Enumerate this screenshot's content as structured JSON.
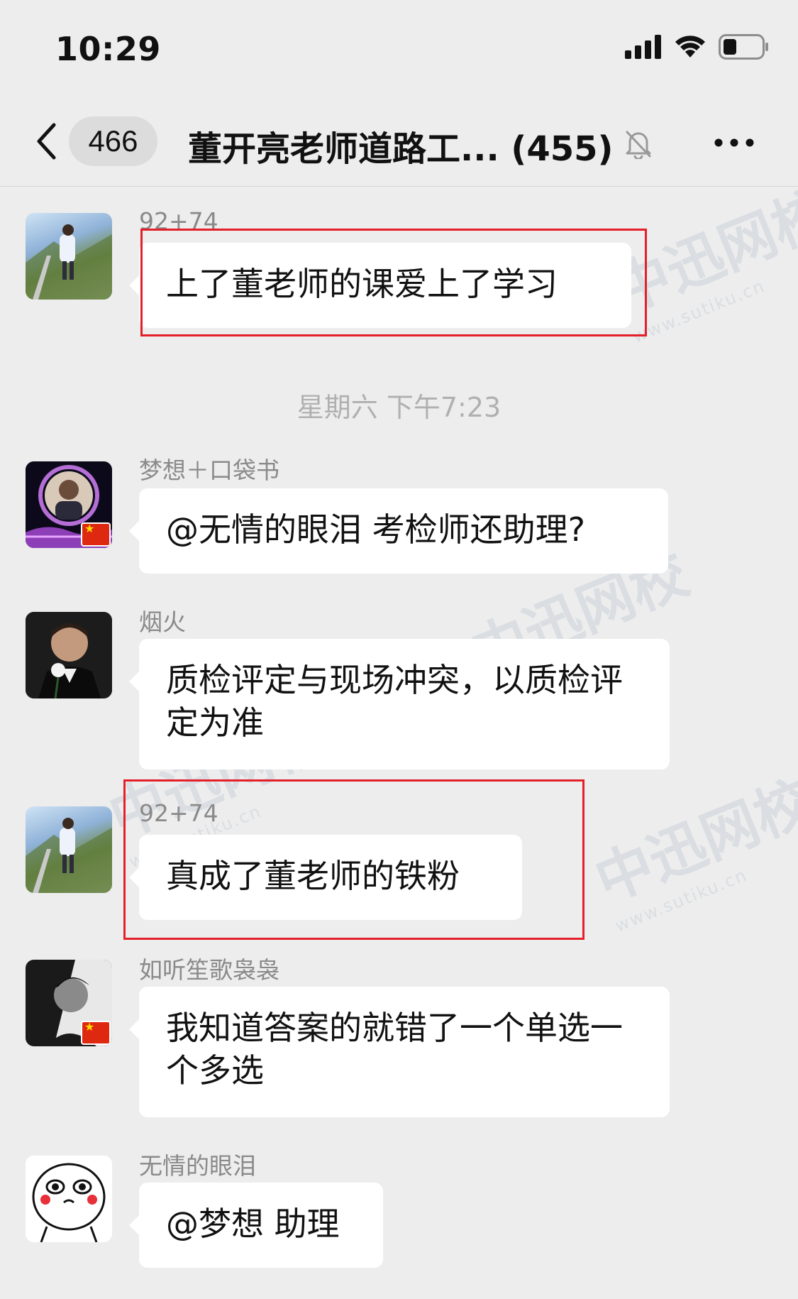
{
  "status_bar": {
    "time": "10:29"
  },
  "header": {
    "unread_count": "466",
    "title": "董开亮老师道路工... (455)"
  },
  "messages": [
    {
      "sender": "92+74",
      "text": "上了董老师的课爱上了学习",
      "avatar": "landscape-avatar"
    },
    {
      "sender": "梦想＋口袋书",
      "text": "@无情的眼泪 考检师还助理?",
      "avatar": "portrait-night-avatar"
    },
    {
      "sender": "烟火",
      "text": "质检评定与现场冲突，以质检评定为准",
      "avatar": "suit-rose-avatar"
    },
    {
      "sender": "92+74",
      "text": "真成了董老师的铁粉",
      "avatar": "landscape-avatar"
    },
    {
      "sender": "如听笙歌袅袅",
      "text": "我知道答案的就错了一个单选一个多选",
      "avatar": "bw-portrait-avatar"
    },
    {
      "sender": "无情的眼泪",
      "text": "@梦想 助理",
      "avatar": "cartoon-face-avatar"
    }
  ],
  "time_separator": "星期六 下午7:23",
  "watermark": {
    "brand": "中迅网校",
    "url": "www.sutiku.cn"
  },
  "colors": {
    "background": "#ededed",
    "bubble": "#ffffff",
    "highlight": "#e3202a",
    "meta_text": "#8a8a8a"
  }
}
